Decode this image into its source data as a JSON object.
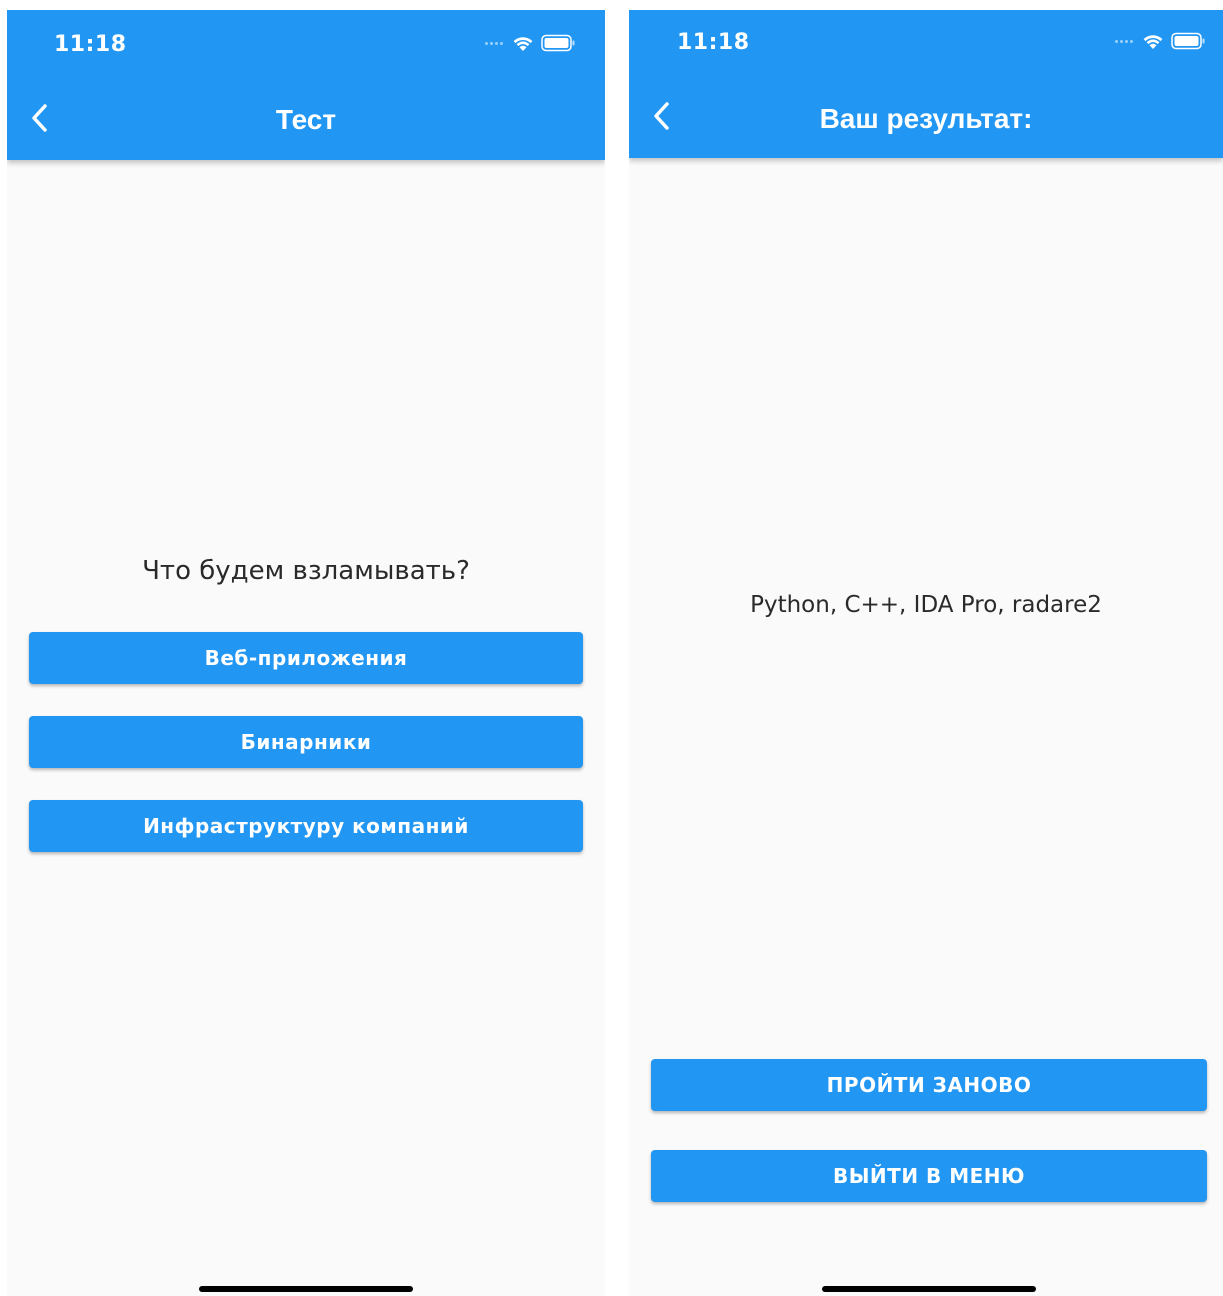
{
  "accent_color": "#2196f3",
  "left_screen": {
    "status_time": "11:18",
    "title": "Тест",
    "question": "Что будем взламывать?",
    "options": [
      {
        "label": "Веб-приложения"
      },
      {
        "label": "Бинарники"
      },
      {
        "label": "Инфраструктуру компаний"
      }
    ]
  },
  "right_screen": {
    "status_time": "11:18",
    "title": "Ваш результат:",
    "result": "Python, C++, IDA Pro, radare2",
    "retry_label": "ПРОЙТИ ЗАНОВО",
    "menu_label": "ВЫЙТИ В МЕНЮ"
  },
  "icons": {
    "back": "chevron-left-icon",
    "wifi": "wifi-icon",
    "battery": "battery-icon",
    "signal": "signal-icon"
  }
}
